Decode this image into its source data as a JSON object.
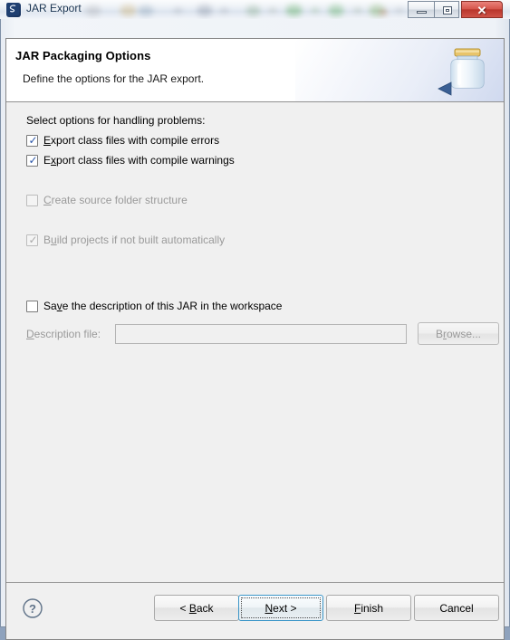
{
  "window": {
    "title": "JAR Export",
    "app_icon": "eclipse-icon",
    "controls": {
      "minimize": "minimize-icon",
      "maximize": "maximize-icon",
      "close": "✕"
    }
  },
  "header": {
    "title": "JAR Packaging Options",
    "subtitle": "Define the options for the JAR export.",
    "icon": "jar-export-banner-icon"
  },
  "body": {
    "group_label": "Select options for handling problems:",
    "checkboxes": [
      {
        "label_pre": "",
        "mnemonic": "E",
        "label_post": "xport class files with compile errors",
        "checked": true,
        "enabled": true,
        "name": "export-class-files-with-compile-errors"
      },
      {
        "label_pre": "E",
        "mnemonic": "x",
        "label_post": "port class files with compile warnings",
        "checked": true,
        "enabled": true,
        "name": "export-class-files-with-compile-warnings"
      },
      {
        "label_pre": "",
        "mnemonic": "C",
        "label_post": "reate source folder structure",
        "checked": false,
        "enabled": false,
        "name": "create-source-folder-structure"
      },
      {
        "label_pre": "B",
        "mnemonic": "u",
        "label_post": "ild projects if not built automatically",
        "checked": true,
        "enabled": false,
        "name": "build-projects-if-not-built-automatically"
      },
      {
        "label_pre": "Sa",
        "mnemonic": "v",
        "label_post": "e the description of this JAR in the workspace",
        "checked": false,
        "enabled": true,
        "name": "save-description-of-jar-in-workspace"
      }
    ],
    "description_file": {
      "label_pre": "",
      "mnemonic": "D",
      "label_post": "escription file:",
      "value": "",
      "placeholder": "",
      "enabled": false,
      "browse_pre": "B",
      "browse_mnemonic": "r",
      "browse_post": "owse..."
    },
    "checkmark_glyph": "✓"
  },
  "footer": {
    "help": "?",
    "buttons": [
      {
        "pre": "< ",
        "mnemonic": "B",
        "post": "ack",
        "focused": false,
        "name": "back-button"
      },
      {
        "pre": "",
        "mnemonic": "N",
        "post": "ext >",
        "focused": true,
        "name": "next-button"
      },
      {
        "pre": "",
        "mnemonic": "F",
        "post": "inish",
        "focused": false,
        "name": "finish-button"
      },
      {
        "pre": "Cancel",
        "mnemonic": "",
        "post": "",
        "focused": false,
        "name": "cancel-button"
      }
    ]
  },
  "colors": {
    "accent_focus": "#3c96c8",
    "title_text": "#16314f",
    "close_button": "#c0392b",
    "checkmark": "#2a55a8",
    "disabled_text": "#9a9a9a",
    "dialog_bg": "#f0f0f0"
  }
}
